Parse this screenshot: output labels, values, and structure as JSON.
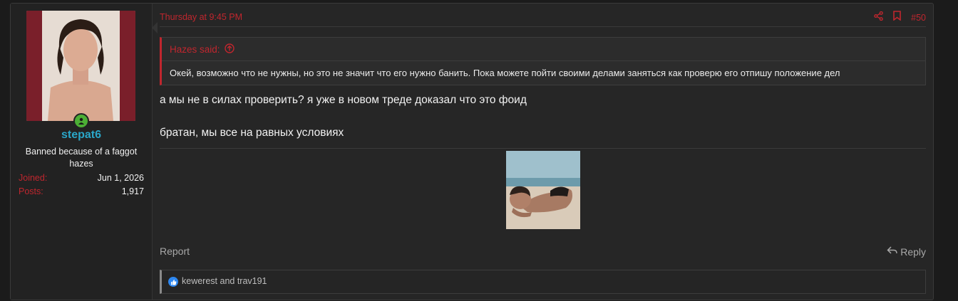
{
  "user": {
    "username": "stepat6",
    "title": "Banned because of a faggot hazes",
    "stats": [
      {
        "label": "Joined:",
        "value": "Jun 1, 2026"
      },
      {
        "label": "Posts:",
        "value": "1,917"
      }
    ]
  },
  "post": {
    "date": "Thursday at 9:45 PM",
    "number": "#50",
    "quote": {
      "author": "Hazes said:",
      "text": "Окей, возможно что не нужны, но это не значит что его нужно банить. Пока можете пойти своими делами заняться как проверю его отпишу положение дел"
    },
    "lines": [
      "а мы не в силах проверить? я уже в новом треде доказал что это фоид",
      "братан, мы все на равных условиях"
    ],
    "actions": {
      "report": "Report",
      "reply": "Reply"
    },
    "reactions": "kewerest and trav191"
  },
  "colors": {
    "accent": "#c0262e",
    "username": "#2aa6c8",
    "online": "#4caf35",
    "like": "#2d87f0"
  },
  "icons": [
    "share-icon",
    "bookmark-icon",
    "arrow-up-circle-icon",
    "reply-icon",
    "like-icon",
    "user-online-icon"
  ]
}
